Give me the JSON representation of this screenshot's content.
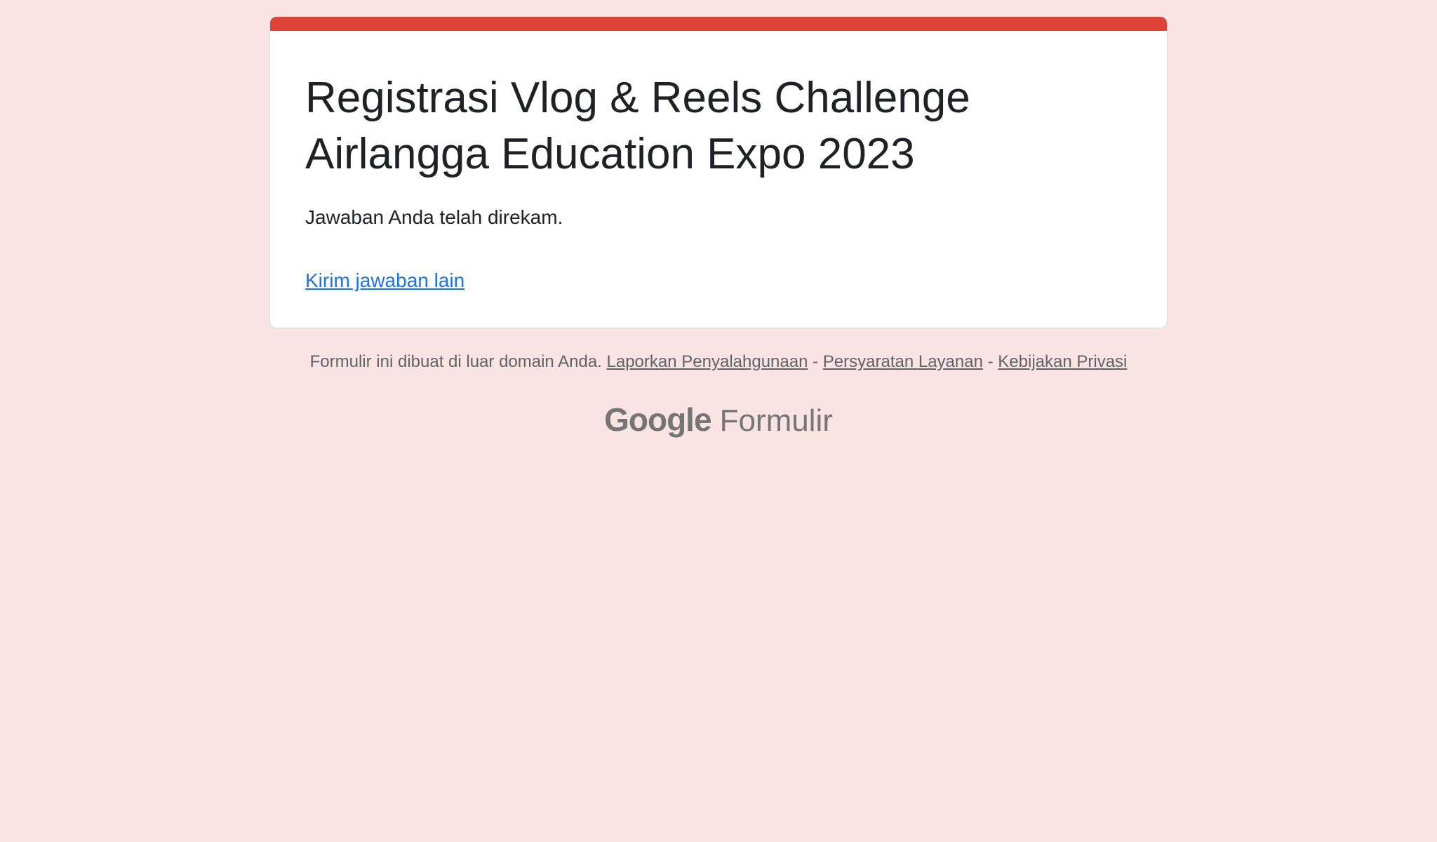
{
  "form": {
    "accent_color": "#db4437",
    "title_line1": "Registrasi Vlog & Reels Challenge",
    "title_line2": "Airlangga Education Expo 2023",
    "confirmation_message": "Jawaban Anda telah direkam.",
    "submit_another_label": "Kirim jawaban lain"
  },
  "footer": {
    "notice": "Formulir ini dibuat di luar domain Anda.",
    "report_abuse_label": "Laporkan Penyalahgunaan",
    "separator": "-",
    "terms_label": "Persyaratan Layanan",
    "privacy_label": "Kebijakan Privasi"
  },
  "branding": {
    "google_label": "Google",
    "product_label": "Formulir"
  }
}
